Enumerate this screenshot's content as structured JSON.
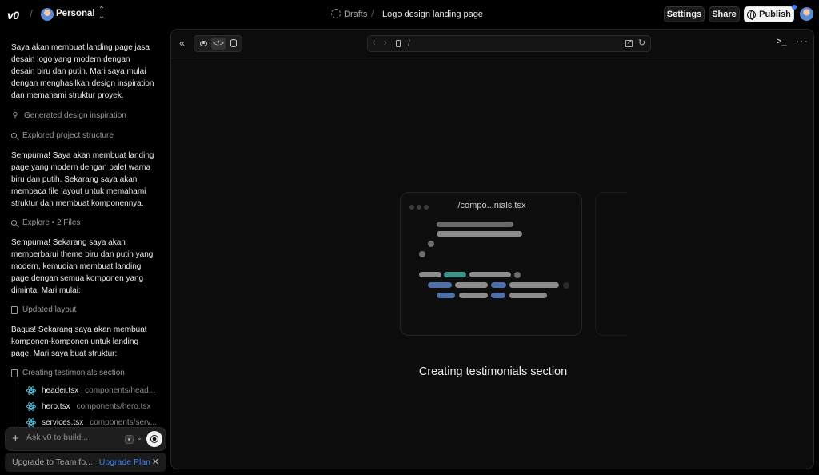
{
  "app": {
    "logo": "v0",
    "workspace": "Personal",
    "breadcrumb_sep": "/"
  },
  "header": {
    "drafts": "Drafts",
    "project_title": "Logo design landing page",
    "settings": "Settings",
    "share": "Share",
    "publish": "Publish"
  },
  "chat": {
    "messages": [
      "Saya akan membuat landing page jasa desain logo yang modern dengan desain biru dan putih. Mari saya mulai dengan menghasilkan design inspiration dan memahami struktur proyek.",
      "Sempurna! Saya akan membuat landing page yang modern dengan palet warna biru dan putih. Sekarang saya akan membaca file layout untuk memahami struktur dan membuat komponennya.",
      "Sempurna! Sekarang saya akan memperbarui theme biru dan putih yang modern, kemudian membuat landing page dengan semua komponen yang diminta. Mari mulai:",
      "Bagus! Sekarang saya akan membuat komponen-komponen untuk landing page. Mari saya buat struktur:"
    ],
    "steps": [
      {
        "label": "Generated design inspiration",
        "icon": "graph-icon"
      },
      {
        "label": "Explored project structure",
        "icon": "search-icon"
      },
      {
        "label": "Explore • 2 Files",
        "icon": "search-icon"
      },
      {
        "label": "Updated layout",
        "icon": "file-icon"
      },
      {
        "label": "Creating testimonials section",
        "icon": "file-icon"
      }
    ],
    "files": [
      {
        "name": "header.tsx",
        "path": "components/head..."
      },
      {
        "name": "hero.tsx",
        "path": "components/hero.tsx"
      },
      {
        "name": "services.tsx",
        "path": "components/serv..."
      }
    ],
    "composer_placeholder": "Ask v0 to build...",
    "upgrade_text": "Upgrade to Team fo...",
    "upgrade_link": "Upgrade Plan"
  },
  "preview": {
    "url_path": "/",
    "card_title": "/compo...nials.tsx",
    "status": "Creating testimonials section"
  },
  "colors": {
    "accent": "#3b82f6",
    "teal": "#3b9488",
    "code_blue": "#4f6fa8"
  }
}
